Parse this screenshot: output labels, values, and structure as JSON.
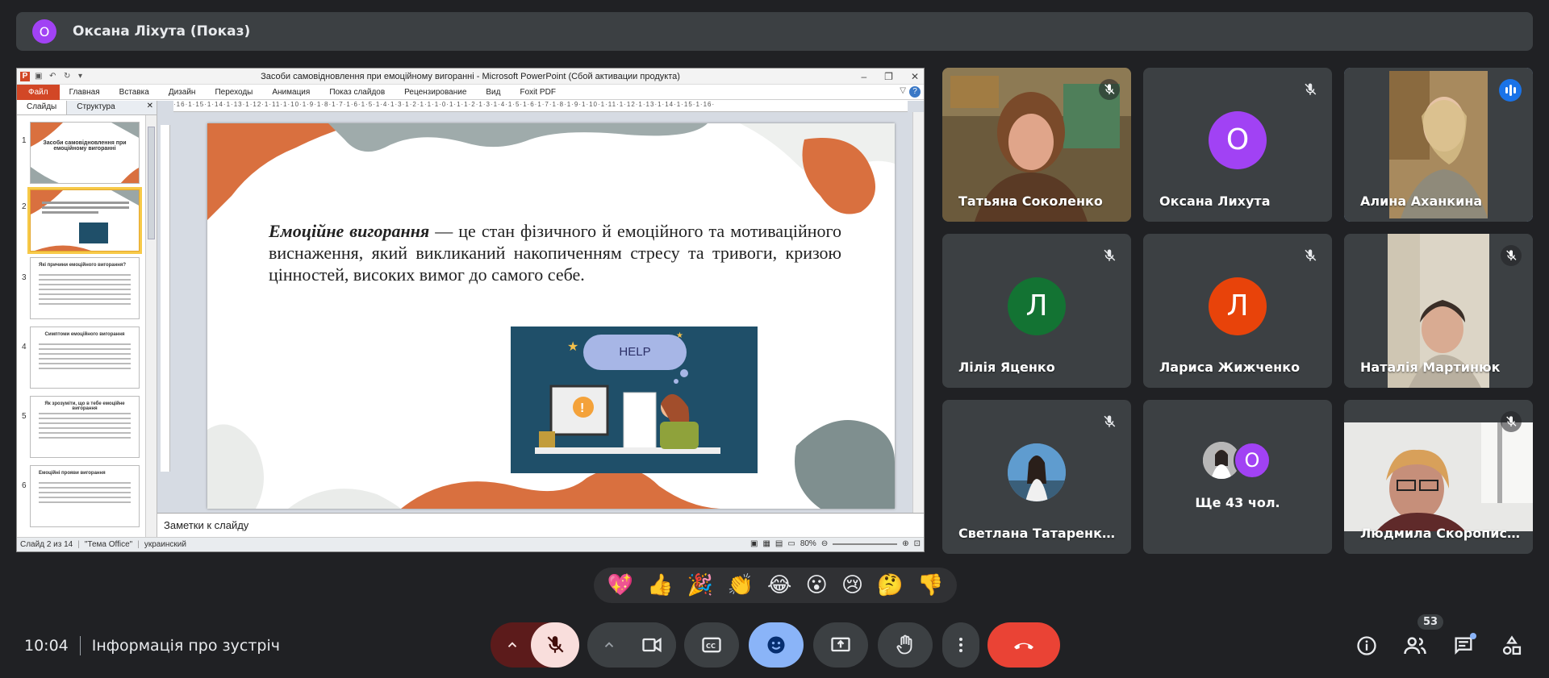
{
  "meeting": {
    "presenter_initial": "О",
    "presenter_title": "Оксана Ліхута (Показ)",
    "time": "10:04",
    "info_label": "Інформація про зустріч",
    "participant_count": "53"
  },
  "ppt": {
    "window_title": "Засоби самовідновлення при емоційному вигоранні  -  Microsoft PowerPoint (Сбой активации продукта)",
    "ribbon_tabs": [
      "Файл",
      "Главная",
      "Вставка",
      "Дизайн",
      "Переходы",
      "Анимация",
      "Показ слайдов",
      "Рецензирование",
      "Вид",
      "Foxit PDF"
    ],
    "pane_tabs": [
      "Слайды",
      "Структура"
    ],
    "thumbnails": [
      {
        "num": "1",
        "title": "Засоби самовідновлення при емоційному вигоранні"
      },
      {
        "num": "2",
        "title": ""
      },
      {
        "num": "3",
        "title": "Які причини емоційного вигорання?"
      },
      {
        "num": "4",
        "title": "Симптоми емоційного вигорання"
      },
      {
        "num": "5",
        "title": "Як зрозуміти, що в тебе емоційне вигорання"
      },
      {
        "num": "6",
        "title": "Емоційні прояви вигорання"
      }
    ],
    "slide_term": "Емоційне вигорання",
    "slide_text": " — це стан фізичного й емоційного та мотиваційного виснаження, який викликаний накопиченням стресу та тривоги, кризою цінностей, високих вимог до самого себе.",
    "slide_image_text": "HELP",
    "notes_placeholder": "Заметки к слайду",
    "status_slide": "Слайд 2 из 14",
    "status_theme": "\"Тема Office\"",
    "status_lang": "украинский",
    "zoom": "80%"
  },
  "tiles": [
    {
      "name": "Татьяна Соколенко",
      "type": "photo",
      "muted": true
    },
    {
      "name": "Оксана Лихута",
      "type": "avatar",
      "initial": "О",
      "color": "#a142f4",
      "muted": true
    },
    {
      "name": "Алина Аханкина",
      "type": "photo",
      "muted": false,
      "speaking": true
    },
    {
      "name": "Лілія Яценко",
      "type": "avatar",
      "initial": "Л",
      "color": "#137333",
      "muted": true
    },
    {
      "name": "Лариса Жижченко",
      "type": "avatar",
      "initial": "Л",
      "color": "#e8430a",
      "muted": true
    },
    {
      "name": "Наталія Мартинюк",
      "type": "photo",
      "muted": true
    },
    {
      "name": "Светлана Татаренкова",
      "type": "photo-avatar",
      "muted": true
    },
    {
      "name": "Ще 43 чол.",
      "type": "more",
      "initial": "О"
    },
    {
      "name": "Людмила Скорописцева",
      "type": "photo",
      "muted": true
    }
  ],
  "reactions": [
    "💖",
    "👍",
    "🎉",
    "👏",
    "😂",
    "😮",
    "😢",
    "🤔",
    "👎"
  ],
  "colors": {
    "background": "#202124",
    "surface": "#3c4043",
    "mic_off_bg": "#f9dedc",
    "reaction_active": "#8ab4f8",
    "leave": "#ea4335"
  }
}
